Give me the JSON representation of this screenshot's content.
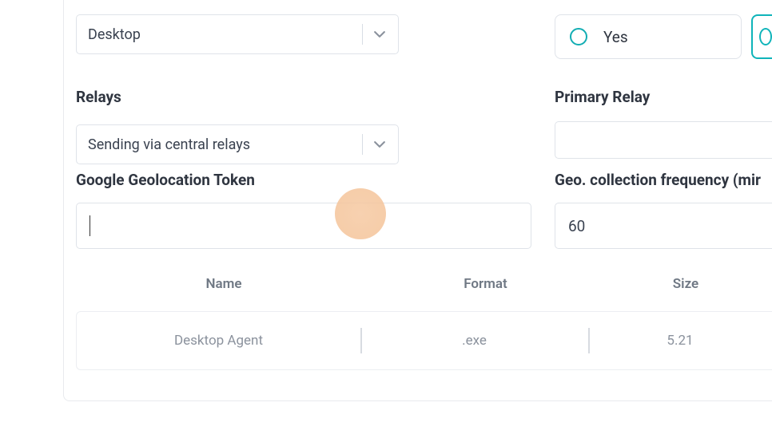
{
  "left": {
    "desktop_select": "Desktop",
    "relays_label": "Relays",
    "relays_select": "Sending via central relays",
    "ggt_label": "Google Geolocation Token",
    "ggt_value": ""
  },
  "right": {
    "yes_label": "Yes",
    "primary_relay_label": "Primary Relay",
    "primary_relay_value": "",
    "geo_freq_label": "Geo. collection frequency (mir",
    "geo_freq_value": "60"
  },
  "table": {
    "headers": {
      "name": "Name",
      "format": "Format",
      "size": "Size"
    },
    "row": {
      "name": "Desktop Agent",
      "format": ".exe",
      "size": "5.21"
    }
  }
}
